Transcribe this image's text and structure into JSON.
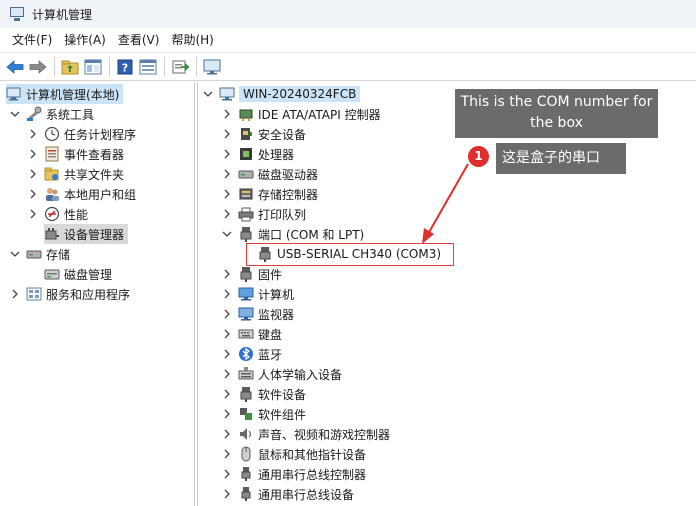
{
  "window": {
    "title": "计算机管理"
  },
  "menu": [
    "文件(F)",
    "操作(A)",
    "查看(V)",
    "帮助(H)"
  ],
  "toolbar_icons": [
    "back-arrow-icon",
    "forward-arrow-icon",
    "folder-up-icon",
    "show-hide-tree-icon",
    "help-icon",
    "properties-icon",
    "export-icon",
    "monitor-icon"
  ],
  "left_tree": {
    "root": "计算机管理(本地)",
    "system_tools": "系统工具",
    "task_scheduler": "任务计划程序",
    "event_viewer": "事件查看器",
    "shared_folders": "共享文件夹",
    "local_users": "本地用户和组",
    "performance": "性能",
    "device_manager": "设备管理器",
    "storage": "存储",
    "disk_management": "磁盘管理",
    "services_apps": "服务和应用程序"
  },
  "right_tree": {
    "root": "WIN-20240324FCB",
    "items": [
      "IDE ATA/ATAPI 控制器",
      "安全设备",
      "处理器",
      "磁盘驱动器",
      "存储控制器",
      "打印队列",
      "端口 (COM 和 LPT)",
      "USB-SERIAL CH340 (COM3)",
      "固件",
      "计算机",
      "监视器",
      "键盘",
      "蓝牙",
      "人体学输入设备",
      "软件设备",
      "软件组件",
      "声音、视频和游戏控制器",
      "鼠标和其他指针设备",
      "通用串行总线控制器",
      "通用串行总线设备"
    ]
  },
  "annotation": {
    "callout_en": "This is the COM number for the box",
    "badge_number": "1",
    "callout_zh": "这是盒子的串口",
    "accent_color": "#e02d2d",
    "callout_bg": "#6b6b6b"
  }
}
